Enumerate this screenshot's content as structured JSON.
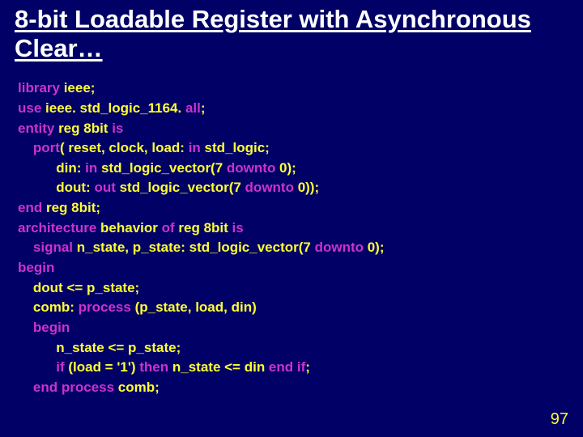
{
  "title": "8-bit Loadable Register with Asynchronous Clear…",
  "page_number": "97",
  "kw": {
    "library": "library",
    "use": "use",
    "all": "all",
    "entity": "entity",
    "is": "is",
    "port": "port",
    "in": "in",
    "downto": "downto",
    "out": "out",
    "end": "end",
    "architecture": "architecture",
    "of": "of",
    "signal": "signal",
    "begin": "begin",
    "process": "process",
    "if": "if",
    "then": "then"
  },
  "txt": {
    "l1a": " ieee;",
    "l2a": " ieee. std_logic_1164. ",
    "l2b": ";",
    "l3a": " reg 8bit ",
    "l4a": "( reset, clock, load: ",
    "l4b": " std_logic;",
    "l5a": "din: ",
    "l5b": " std_logic_vector(7 ",
    "l5c": " 0);",
    "l6a": "dout: ",
    "l6b": " std_logic_vector(7 ",
    "l6c": " 0));",
    "l7a": " reg 8bit;",
    "l8a": " behavior ",
    "l8b": " reg 8bit ",
    "l9a": " n_state, p_state: std_logic_vector(7 ",
    "l9b": " 0);",
    "l11a": "dout <= p_state;",
    "l12a": "comb: ",
    "l12b": " (p_state, load, din)",
    "l14a": "n_state <= p_state;",
    "l15a": " (load = '1') ",
    "l15b": " n_state <= din ",
    "l15c": " ",
    "l15d": ";",
    "l16a": " ",
    "l16b": " comb;"
  },
  "indent": {
    "i0": "",
    "i1": "    ",
    "i2": "          ",
    "i3": "              "
  }
}
